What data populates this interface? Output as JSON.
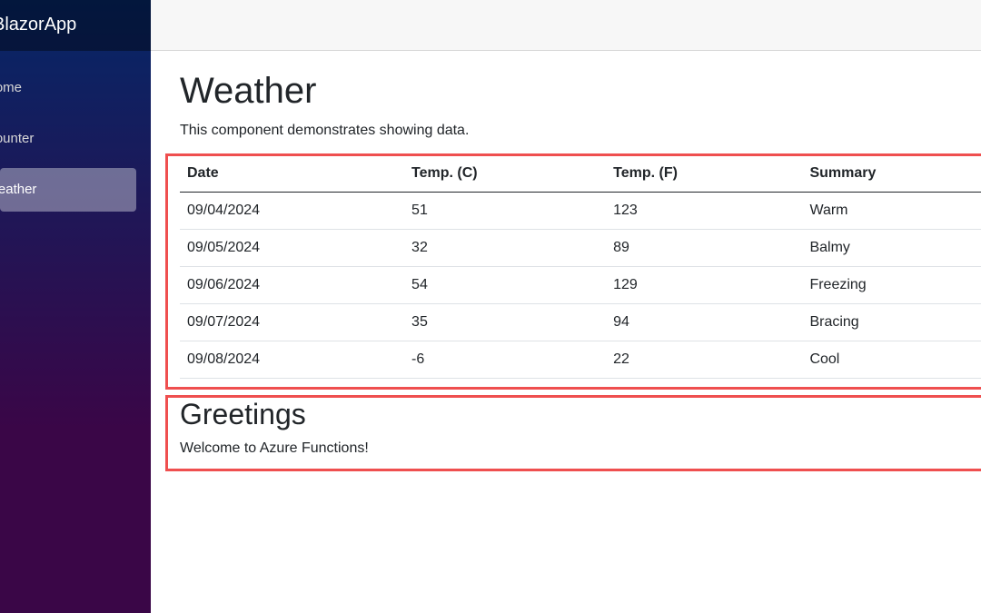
{
  "sidebar": {
    "brand": "BlazorApp",
    "items": [
      {
        "label": "Home",
        "active": false
      },
      {
        "label": "Counter",
        "active": false
      },
      {
        "label": "Weather",
        "active": true
      }
    ]
  },
  "main": {
    "title": "Weather",
    "description": "This component demonstrates showing data.",
    "table": {
      "headers": [
        "Date",
        "Temp. (C)",
        "Temp. (F)",
        "Summary"
      ],
      "rows": [
        [
          "09/04/2024",
          "51",
          "123",
          "Warm"
        ],
        [
          "09/05/2024",
          "32",
          "89",
          "Balmy"
        ],
        [
          "09/06/2024",
          "54",
          "129",
          "Freezing"
        ],
        [
          "09/07/2024",
          "35",
          "94",
          "Bracing"
        ],
        [
          "09/08/2024",
          "-6",
          "22",
          "Cool"
        ]
      ]
    },
    "greetings": {
      "title": "Greetings",
      "message": "Welcome to Azure Functions!"
    }
  },
  "colors": {
    "highlight": "#ef4f4f",
    "sidebar_top": "#052767",
    "sidebar_bottom": "#3a0647"
  }
}
